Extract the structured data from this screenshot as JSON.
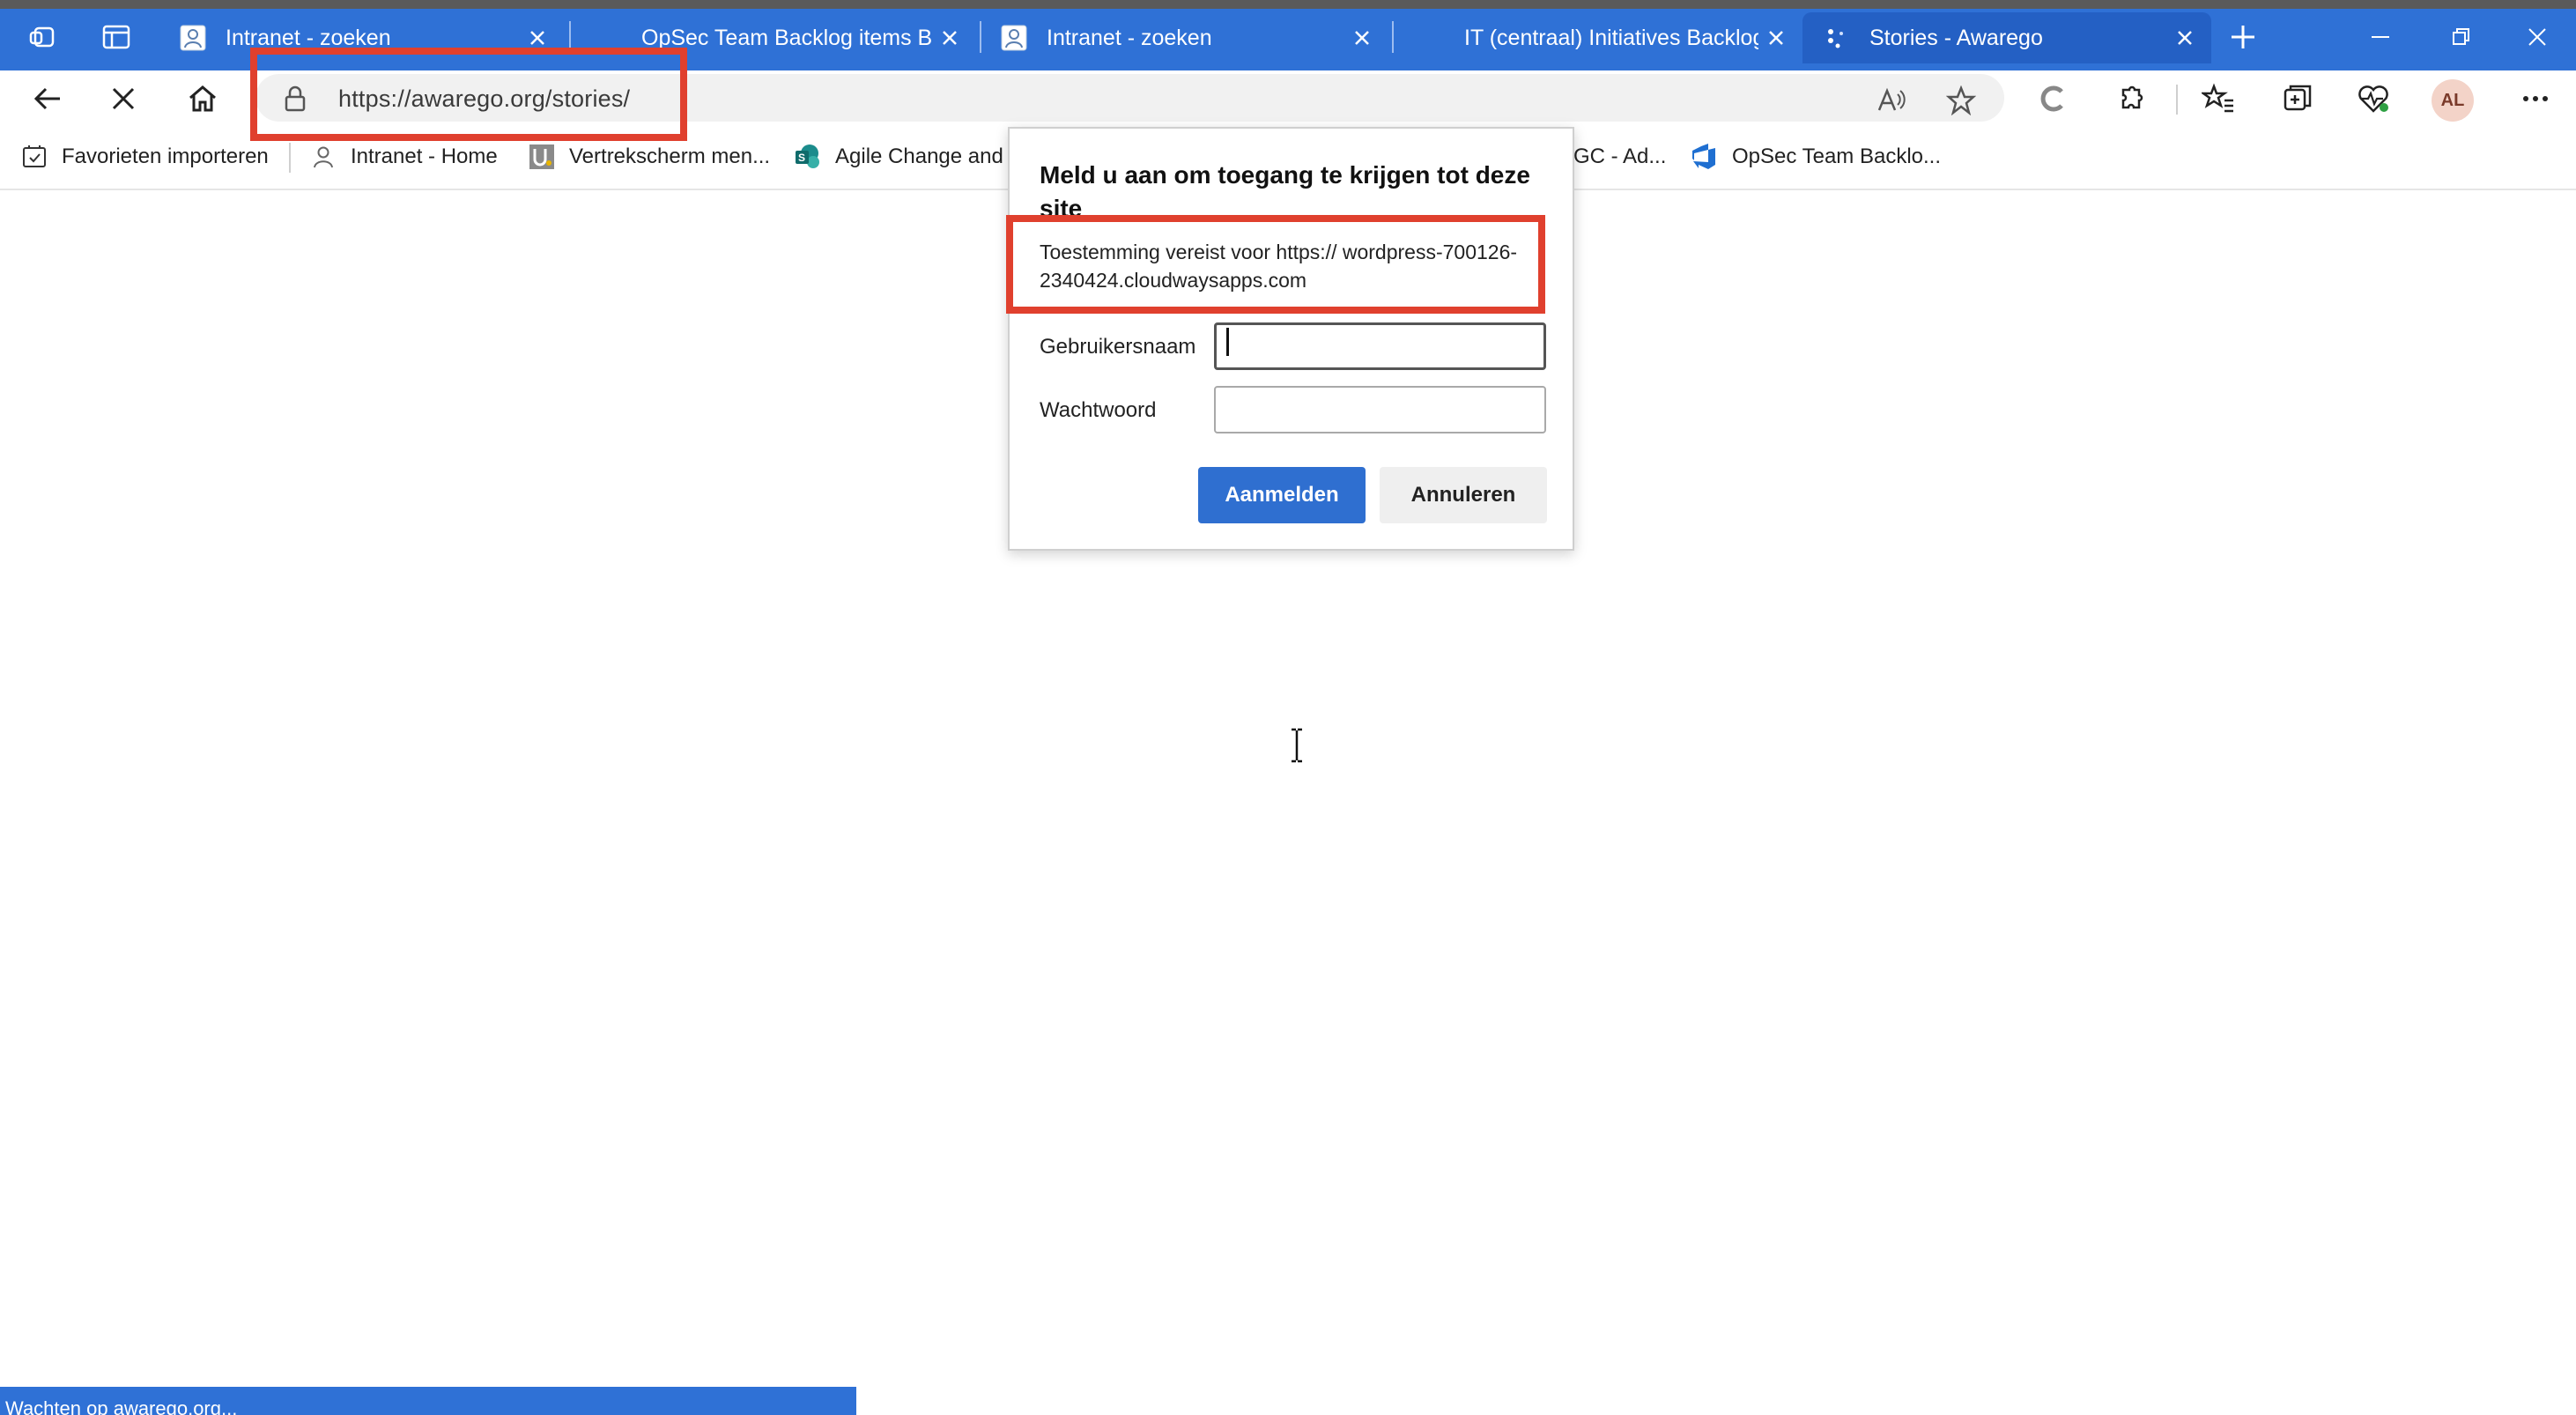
{
  "tabs": [
    {
      "title": "Intranet - zoeken",
      "active": false
    },
    {
      "title": "OpSec Team Backlog items Boa",
      "active": false
    },
    {
      "title": "Intranet - zoeken",
      "active": false
    },
    {
      "title": "IT (centraal) Initiatives Backlog",
      "active": false
    },
    {
      "title": "Stories - Awarego",
      "active": true
    }
  ],
  "address_bar": {
    "url": "https://awarego.org/stories/"
  },
  "toolbar": {
    "profile_initials": "AL"
  },
  "bookmarks": [
    {
      "label": "Favorieten importeren",
      "icon": "import-icon"
    },
    {
      "label": "Intranet - Home",
      "icon": "person-icon"
    },
    {
      "label": "Vertrekscherm men...",
      "icon": "u-logo-icon"
    },
    {
      "label": "Agile Change and",
      "icon": "sharepoint-icon"
    },
    {
      "label": "GC - Ad...",
      "icon": ""
    },
    {
      "label": "OpSec Team Backlo...",
      "icon": "azure-devops-icon"
    }
  ],
  "dialog": {
    "title": "Meld u aan om toegang te krijgen tot deze site",
    "message": "Toestemming vereist voor https:// wordpress-700126-2340424.cloudwaysapps.com",
    "username_label": "Gebruikersnaam",
    "password_label": "Wachtwoord",
    "username_value": "",
    "password_value": "",
    "signin_label": "Aanmelden",
    "cancel_label": "Annuleren"
  },
  "status_bar": {
    "text": "Wachten op awarego.org..."
  },
  "colors": {
    "tabstrip": "#2f71d6",
    "highlight": "#e0402e",
    "primary_button": "#2f6fd0"
  }
}
